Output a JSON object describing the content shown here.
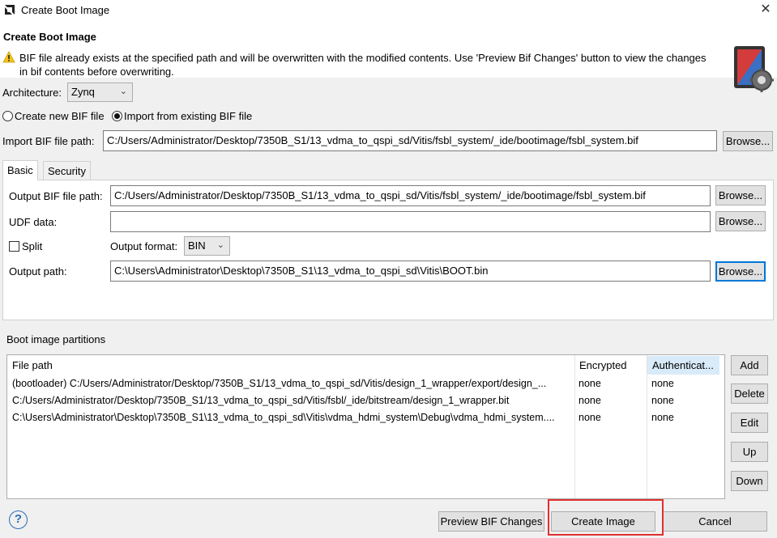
{
  "window": {
    "title": "Create Boot Image",
    "close_glyph": "✕"
  },
  "header": {
    "title": "Create Boot Image",
    "warning": "BIF file already exists at the specified path and will be overwritten with the modified contents. Use 'Preview Bif Changes' button to view the changes in bif contents before overwriting."
  },
  "architecture": {
    "label": "Architecture:",
    "value": "Zynq"
  },
  "bif_mode": {
    "create_label": "Create new BIF file",
    "import_label": "Import from existing BIF file",
    "selected": "import"
  },
  "import_bif": {
    "label": "Import BIF file path:",
    "value": "C:/Users/Administrator/Desktop/7350B_S1/13_vdma_to_qspi_sd/Vitis/fsbl_system/_ide/bootimage/fsbl_system.bif",
    "browse": "Browse..."
  },
  "tabs": [
    {
      "label": "Basic",
      "active": true
    },
    {
      "label": "Security",
      "active": false
    }
  ],
  "basic": {
    "output_bif": {
      "label": "Output BIF file path:",
      "value": "C:/Users/Administrator/Desktop/7350B_S1/13_vdma_to_qspi_sd/Vitis/fsbl_system/_ide/bootimage/fsbl_system.bif",
      "browse": "Browse..."
    },
    "udf": {
      "label": "UDF data:",
      "value": "",
      "browse": "Browse..."
    },
    "split": {
      "label": "Split",
      "checked": false
    },
    "output_format": {
      "label": "Output format:",
      "value": "BIN"
    },
    "output_path": {
      "label": "Output path:",
      "value": "C:\\Users\\Administrator\\Desktop\\7350B_S1\\13_vdma_to_qspi_sd\\Vitis\\BOOT.bin",
      "browse": "Browse..."
    }
  },
  "partitions": {
    "label": "Boot image partitions",
    "columns": [
      "File path",
      "Encrypted",
      "Authenticat..."
    ],
    "rows": [
      {
        "path": "(bootloader) C:/Users/Administrator/Desktop/7350B_S1/13_vdma_to_qspi_sd/Vitis/design_1_wrapper/export/design_...",
        "encrypted": "none",
        "auth": "none"
      },
      {
        "path": "C:/Users/Administrator/Desktop/7350B_S1/13_vdma_to_qspi_sd/Vitis/fsbl/_ide/bitstream/design_1_wrapper.bit",
        "encrypted": "none",
        "auth": "none"
      },
      {
        "path": "C:\\Users\\Administrator\\Desktop\\7350B_S1\\13_vdma_to_qspi_sd\\Vitis\\vdma_hdmi_system\\Debug\\vdma_hdmi_system....",
        "encrypted": "none",
        "auth": "none"
      }
    ],
    "buttons": {
      "add": "Add",
      "delete": "Delete",
      "edit": "Edit",
      "up": "Up",
      "down": "Down"
    }
  },
  "footer": {
    "help": "?",
    "preview": "Preview BIF Changes",
    "create": "Create Image",
    "cancel": "Cancel"
  },
  "colors": {
    "accent": "#0078d7",
    "highlight": "#e03030",
    "warning": "#f5c518"
  }
}
